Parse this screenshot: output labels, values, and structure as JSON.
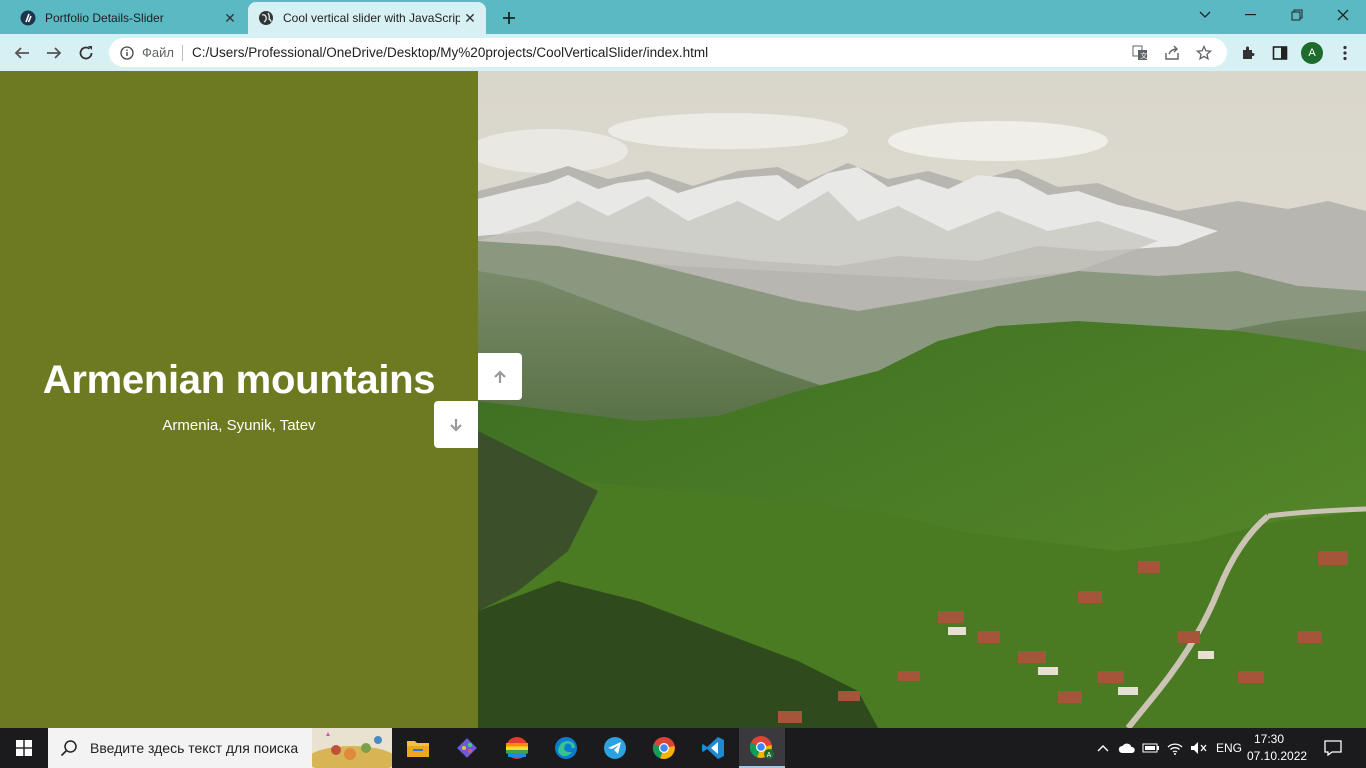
{
  "browser": {
    "tabs": [
      {
        "title": "Portfolio Details-Slider",
        "icon": "app-icon",
        "active": false
      },
      {
        "title": "Cool vertical slider with JavaScrip",
        "icon": "globe-icon",
        "active": true
      }
    ],
    "address": {
      "scheme_label": "Файл",
      "url": "C:/Users/Professional/OneDrive/Desktop/My%20projects/CoolVerticalSlider/index.html"
    },
    "profile_initial": "A"
  },
  "slide": {
    "title": "Armenian mountains",
    "subtitle": "Armenia, Syunik, Tatev",
    "color": "#6d7a22"
  },
  "taskbar": {
    "search_placeholder": "Введите здесь текст для поиска",
    "language": "ENG",
    "time": "17:30",
    "date": "07.10.2022"
  }
}
